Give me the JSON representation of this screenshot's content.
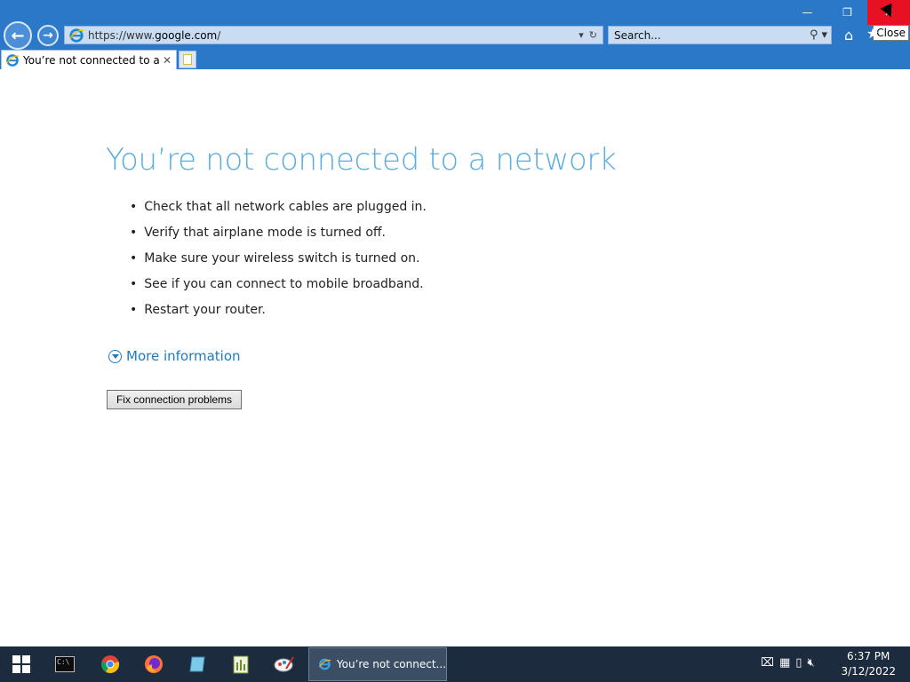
{
  "window": {
    "minimize_icon": "minimize-icon",
    "restore_icon": "restore-icon",
    "close_icon": "close-icon",
    "close_tooltip": "Close"
  },
  "address_bar": {
    "url_prefix": "https://www.",
    "url_domain": "google.com",
    "url_suffix": "/"
  },
  "search_box": {
    "placeholder": "Search..."
  },
  "tab": {
    "title": "You’re not connected to a n..."
  },
  "page": {
    "heading": "You’re not connected to a network",
    "tips": [
      "Check that all network cables are plugged in.",
      "Verify that airplane mode is turned off.",
      "Make sure your wireless switch is turned on.",
      "See if you can connect to mobile broadband.",
      "Restart your router."
    ],
    "more_info": "More information",
    "fix_button": "Fix connection problems"
  },
  "taskbar": {
    "active_task_label": "You’re not connect...",
    "time": "6:37 PM",
    "date": "3/12/2022"
  },
  "colors": {
    "chrome_blue": "#2b78c9",
    "heading_blue": "#5aaee0",
    "link_blue": "#1a7cc4",
    "close_red": "#e81123",
    "taskbar": "#1c2b3d"
  }
}
